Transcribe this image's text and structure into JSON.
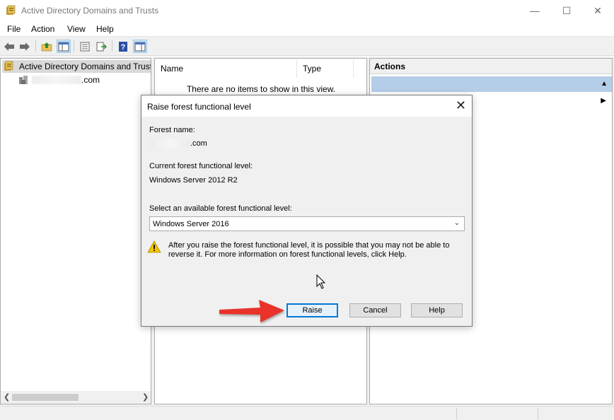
{
  "window": {
    "title": "Active Directory Domains and Trusts",
    "min_glyph": "—",
    "max_glyph": "☐",
    "close_glyph": "✕"
  },
  "menu": [
    "File",
    "Action",
    "View",
    "Help"
  ],
  "toolbar": [
    "back-icon",
    "forward-icon",
    "up-folder-icon",
    "show-hide-tree-icon",
    "properties-icon",
    "export-list-icon",
    "help-icon",
    "show-action-pane-icon"
  ],
  "tree": {
    "root_label": "Active Directory Domains and Trusts",
    "child_suffix": ".com"
  },
  "list": {
    "col_name": "Name",
    "col_type": "Type",
    "empty_message": "There are no items to show in this view."
  },
  "actions": {
    "header": "Actions"
  },
  "dialog": {
    "title": "Raise forest functional level",
    "forest_name_label": "Forest name:",
    "forest_name_suffix": ".com",
    "current_level_label": "Current forest functional level:",
    "current_level_value": "Windows Server 2012 R2",
    "select_label": "Select an available forest functional level:",
    "select_value": "Windows Server 2016",
    "warning_line1": "After you raise the forest functional level, it is possible that you may not be able to",
    "warning_line2": "reverse it. For more information on forest functional levels, click Help.",
    "raise_button": "Raise",
    "cancel_button": "Cancel",
    "help_button": "Help"
  },
  "colors": {
    "accent": "#0078d7",
    "annotation_arrow": "#e8322b",
    "action_band": "#b4cde8"
  }
}
